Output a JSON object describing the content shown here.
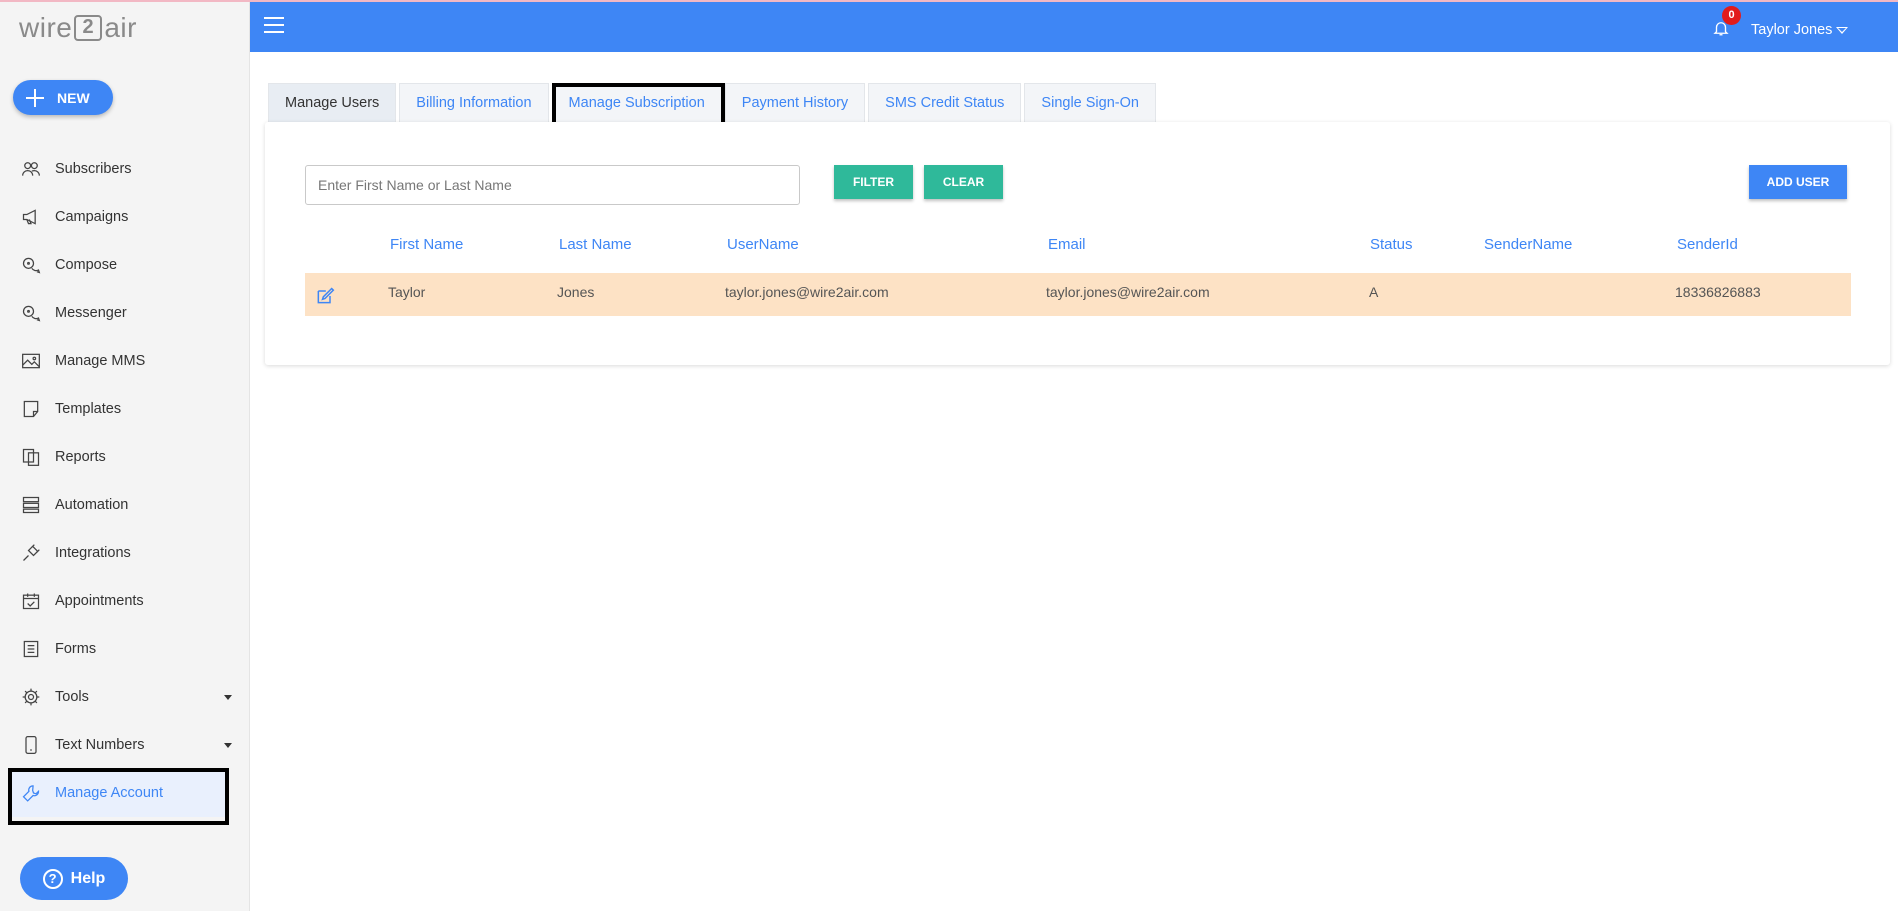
{
  "app": {
    "logo_text_left": "wire",
    "logo_badge": "2",
    "logo_text_right": "air"
  },
  "sidebar": {
    "new_label": "NEW",
    "items": [
      {
        "label": "Subscribers",
        "icon": "users-icon"
      },
      {
        "label": "Campaigns",
        "icon": "megaphone-icon"
      },
      {
        "label": "Compose",
        "icon": "chat-bubbles-icon"
      },
      {
        "label": "Messenger",
        "icon": "chat-bubbles-icon"
      },
      {
        "label": "Manage MMS",
        "icon": "image-icon"
      },
      {
        "label": "Templates",
        "icon": "note-icon"
      },
      {
        "label": "Reports",
        "icon": "copy-icon"
      },
      {
        "label": "Automation",
        "icon": "server-icon"
      },
      {
        "label": "Integrations",
        "icon": "plug-icon"
      },
      {
        "label": "Appointments",
        "icon": "calendar-check-icon"
      },
      {
        "label": "Forms",
        "icon": "form-icon"
      },
      {
        "label": "Tools",
        "icon": "gear-icon"
      },
      {
        "label": "Text Numbers",
        "icon": "phone-icon"
      },
      {
        "label": "Manage Account",
        "icon": "wrench-icon"
      }
    ],
    "help_label": "Help"
  },
  "header": {
    "notification_count": "0",
    "user_name": "Taylor Jones"
  },
  "tabs": [
    "Manage Users",
    "Billing Information",
    "Manage Subscription",
    "Payment History",
    "SMS Credit Status",
    "Single Sign-On"
  ],
  "filter": {
    "placeholder": "Enter First Name or Last Name",
    "filter_label": "FILTER",
    "clear_label": "CLEAR",
    "add_user_label": "ADD USER"
  },
  "table": {
    "columns": [
      "First Name",
      "Last Name",
      "UserName",
      "Email",
      "Status",
      "SenderName",
      "SenderId"
    ],
    "rows": [
      {
        "first_name": "Taylor",
        "last_name": "Jones",
        "username": "taylor.jones@wire2air.com",
        "email": "taylor.jones@wire2air.com",
        "status": "A",
        "sender_name": "",
        "sender_id": "18336826883"
      }
    ]
  },
  "colors": {
    "accent": "#3e86f5",
    "green": "#2fb99a",
    "row_highlight": "#fde2c5",
    "badge": "#e21b1b"
  }
}
